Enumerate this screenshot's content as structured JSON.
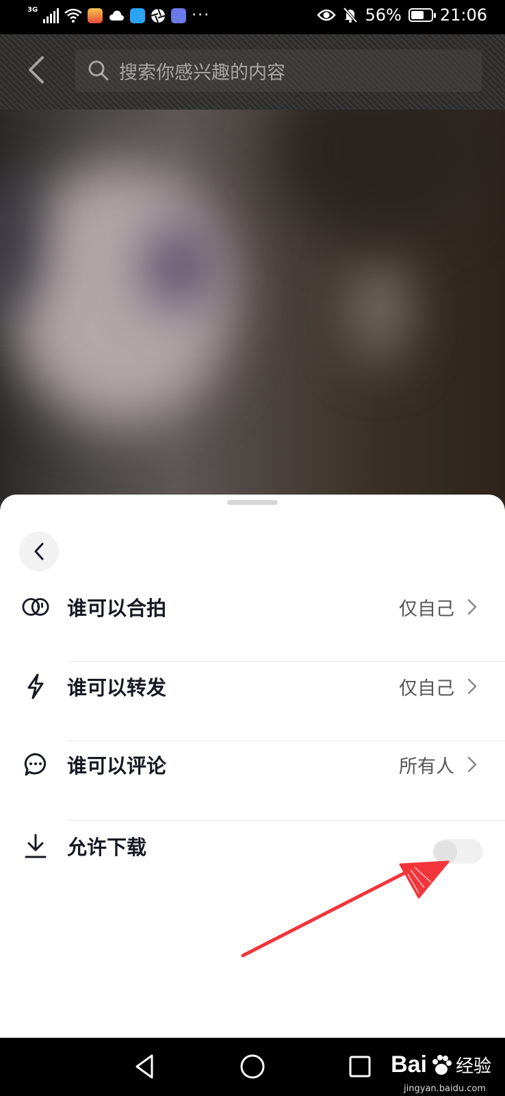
{
  "status_bar": {
    "network": "3G",
    "battery": "56%",
    "time": "21:06",
    "more": "···"
  },
  "search": {
    "placeholder": "搜索你感兴趣的内容"
  },
  "settings": {
    "rows": [
      {
        "label": "谁可以合拍",
        "value": "仅自己",
        "icon": "duet-icon"
      },
      {
        "label": "谁可以转发",
        "value": "仅自己",
        "icon": "lightning-icon"
      },
      {
        "label": "谁可以评论",
        "value": "所有人",
        "icon": "comment-icon"
      },
      {
        "label": "允许下载",
        "icon": "download-icon",
        "toggle_on": false
      }
    ]
  },
  "watermark": {
    "logo": "Bai",
    "logo_suffix": "经验",
    "url": "jingyan.baidu.com"
  },
  "colors": {
    "annotation_arrow": "#f2353b",
    "sheet_text": "#161823"
  }
}
